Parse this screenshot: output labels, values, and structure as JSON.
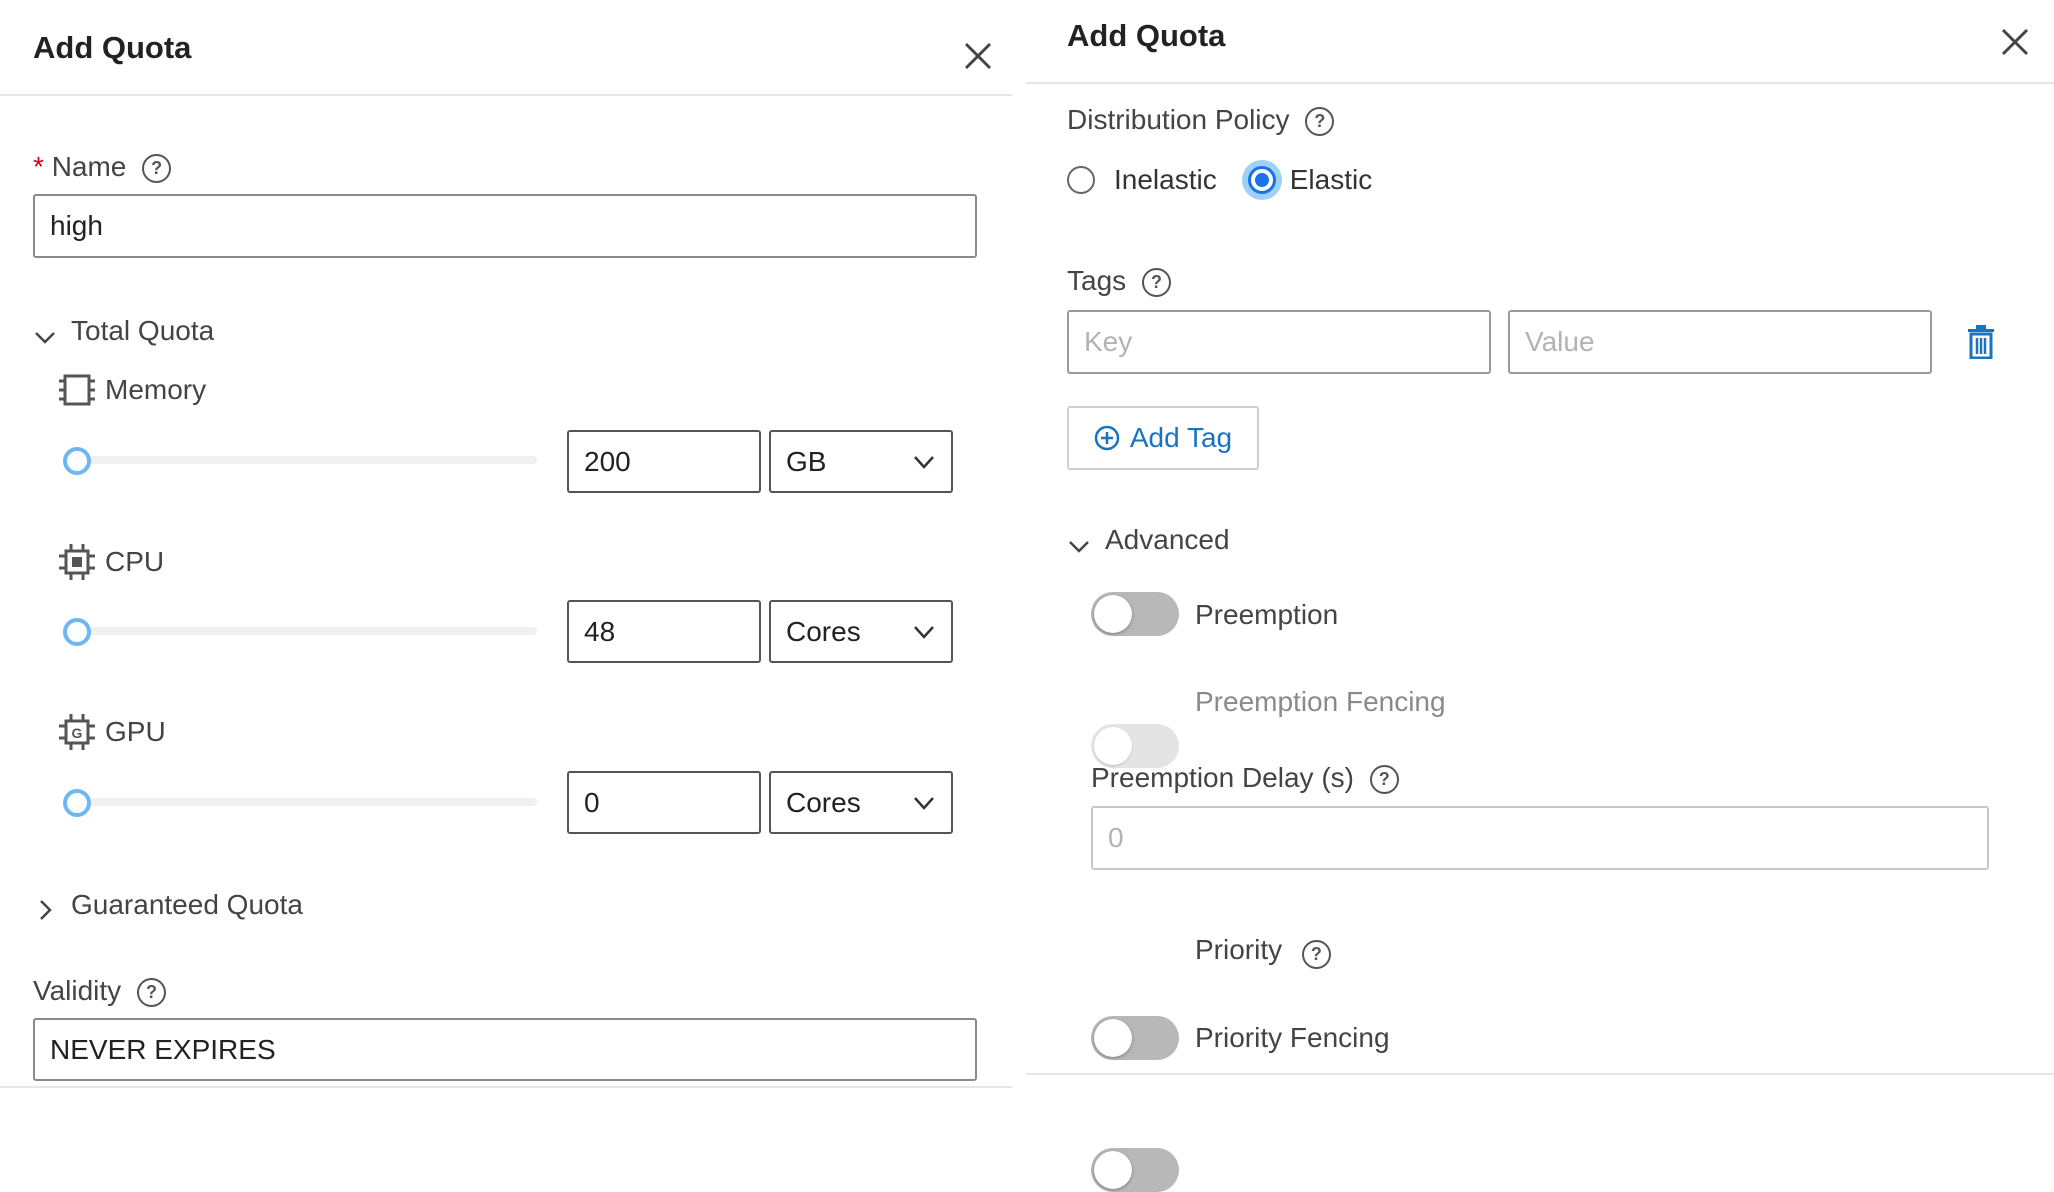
{
  "left_panel": {
    "title": "Add Quota",
    "name_field": {
      "required_mark": "*",
      "label": "Name",
      "value": "high"
    },
    "total_quota": {
      "label": "Total Quota",
      "resources": [
        {
          "label": "Memory",
          "icon": "memory-icon",
          "value": "200",
          "unit": "GB",
          "slider_fraction": 0
        },
        {
          "label": "CPU",
          "icon": "cpu-icon",
          "value": "48",
          "unit": "Cores",
          "slider_fraction": 0
        },
        {
          "label": "GPU",
          "icon": "gpu-icon",
          "value": "0",
          "unit": "Cores",
          "slider_fraction": 0
        }
      ]
    },
    "guaranteed_quota": {
      "label": "Guaranteed Quota"
    },
    "validity": {
      "label": "Validity",
      "value": "NEVER EXPIRES"
    }
  },
  "right_panel": {
    "title": "Add Quota",
    "distribution_policy": {
      "label": "Distribution Policy",
      "options": [
        {
          "label": "Inelastic",
          "selected": false
        },
        {
          "label": "Elastic",
          "selected": true
        }
      ]
    },
    "tags": {
      "label": "Tags",
      "key_placeholder": "Key",
      "value_placeholder": "Value",
      "add_tag_label": "Add Tag"
    },
    "advanced": {
      "label": "Advanced",
      "preemption": {
        "label": "Preemption",
        "on": false
      },
      "preemption_fencing": {
        "label": "Preemption Fencing",
        "on": false,
        "disabled": true
      },
      "preemption_delay": {
        "label": "Preemption Delay (s)",
        "placeholder": "0"
      },
      "priority": {
        "label": "Priority",
        "on": false
      },
      "priority_fencing": {
        "label": "Priority Fencing",
        "on": false
      }
    }
  },
  "help_glyph": "?",
  "colors": {
    "accent": "#1a73e8",
    "link": "#1a73c0",
    "required": "#d0021b",
    "slider_thumb": "#6db7f2"
  }
}
